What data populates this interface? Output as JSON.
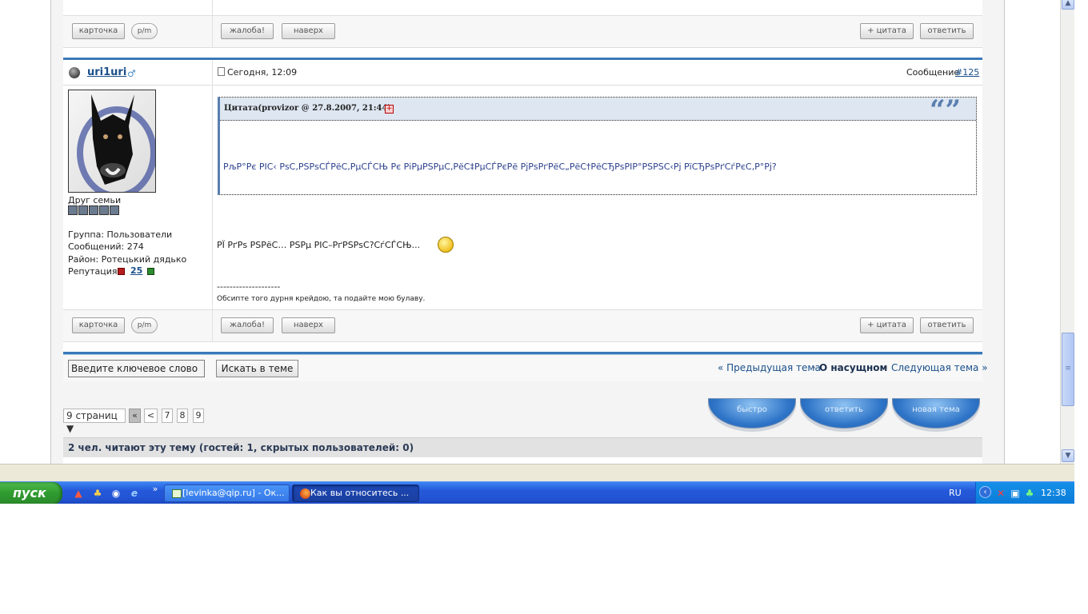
{
  "post_prev_footer": {
    "card_label": "карточка",
    "pm_label": "p/m",
    "complaint_label": "жалоба!",
    "top_label": "наверх",
    "quote_label": "+ цитата",
    "reply_label": "ответить"
  },
  "post": {
    "username": "uri1uri",
    "date": "Сегодня, 12:09",
    "message_prefix": "Сообщение",
    "message_number": "#125",
    "user_title": "Друг семьи",
    "rank_pips": 5,
    "group": "Группа: Пользователи",
    "posts": "Сообщений: 274",
    "district": "Район: Ротецький дядько",
    "reputation_label": "Репутация:",
    "reputation_value": "25",
    "quote_header": "Цитата(provizor @ 27.8.2007, 21:44)",
    "quote_text": "РљР°Рє РІС‹ РѕС‚РЅРѕСЃРёС‚РµСЃСЊ Рє РіРµРЅРµС‚РёС‡РµСЃРєРё РјРѕРґРёС„РёС†РёСЂРѕРІР°РЅРЅС‹Рј РїСЂРѕРґСѓРєС‚Р°Рј?",
    "body_text": "РЇ РґРѕ РЅРёС… РЅРµ РІС–РґРЅРѕС?СѓСЃСЊ...",
    "signature_sep": "--------------------",
    "signature": "Обсипте того дурня крейдою, та подайте мою булаву."
  },
  "post_footer": {
    "card_label": "карточка",
    "pm_label": "p/m",
    "complaint_label": "жалоба!",
    "top_label": "наверх",
    "quote_label": "+ цитата",
    "reply_label": "ответить"
  },
  "search": {
    "input_value": "Введите ключевое слово",
    "button_label": "Искать в теме"
  },
  "topic_nav": {
    "prev": "« Предыдущая тема",
    "dot1": "·",
    "current": "О насущном",
    "dot2": "·",
    "next": "Следующая тема »"
  },
  "pagination": {
    "pages_label": "9 страниц ▼",
    "first": "«",
    "prev": "<",
    "pages": [
      "7",
      "8",
      "9"
    ]
  },
  "action_buttons": {
    "fast": "быстро",
    "reply": "ответить",
    "new_topic": "новая тема"
  },
  "readers": "2 чел. читают эту тему (гостей: 1, скрытых пользователей: 0)",
  "taskbar": {
    "start_label": "пуск",
    "chevron": "»",
    "task1": "[levinka@qip.ru] - Ок...",
    "task2": "Как вы относитесь ...",
    "lang": "RU",
    "time": "12:38"
  },
  "scrollbar": {
    "up": "▲",
    "down": "▼",
    "grip": "≡"
  },
  "colors": {
    "link": "#1a4f8a",
    "accent": "#3a78b8",
    "taskbar": "#2458d9",
    "start": "#2f9b2f"
  }
}
